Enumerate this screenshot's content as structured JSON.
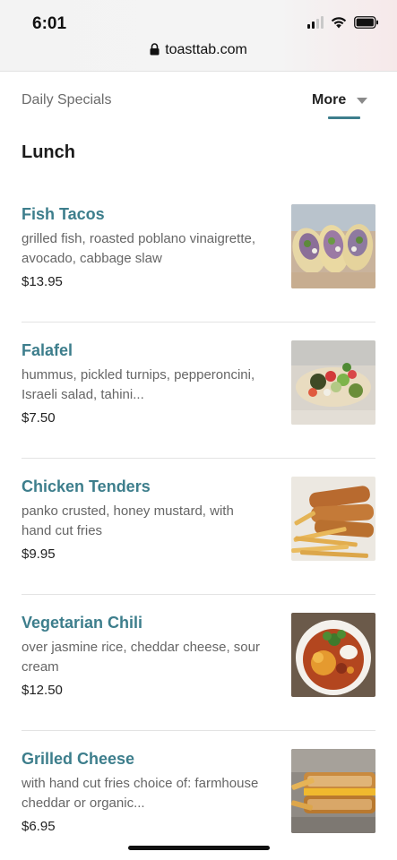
{
  "status": {
    "time": "6:01",
    "url": "toasttab.com"
  },
  "tabs": {
    "daily": "Daily Specials",
    "more": "More"
  },
  "section": {
    "title": "Lunch"
  },
  "items": [
    {
      "name": "Fish Tacos",
      "description": "grilled fish, roasted poblano vinaigrette, avocado, cabbage slaw",
      "price": "$13.95"
    },
    {
      "name": "Falafel",
      "description": "hummus, pickled turnips, pepperoncini, Israeli salad, tahini...",
      "price": "$7.50"
    },
    {
      "name": "Chicken Tenders",
      "description": "panko crusted, honey mustard, with hand cut fries",
      "price": "$9.95"
    },
    {
      "name": "Vegetarian Chili",
      "description": "over jasmine rice, cheddar cheese, sour cream",
      "price": "$12.50"
    },
    {
      "name": "Grilled Cheese",
      "description": "with hand cut fries choice of: farmhouse cheddar or organic...",
      "price": "$6.95"
    }
  ],
  "colors": {
    "accent": "#3d7e8c",
    "text": "#222222",
    "muted": "#666666"
  }
}
